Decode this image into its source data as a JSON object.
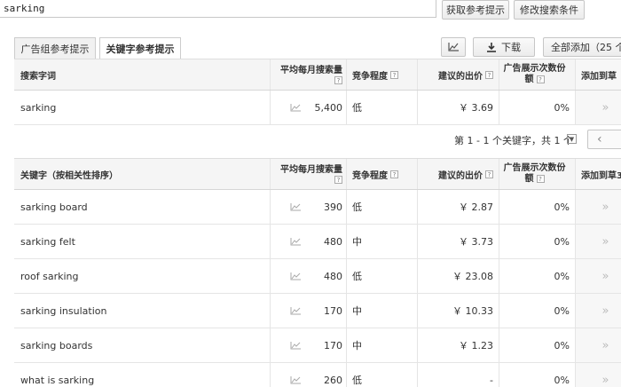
{
  "search": {
    "value": "sarking"
  },
  "buttons": {
    "get_ideas": "获取参考提示",
    "modify": "修改搜索条件"
  },
  "tabs": [
    {
      "label": "广告组参考提示"
    },
    {
      "label": "关键字参考提示"
    }
  ],
  "toolbar": {
    "download": "下载",
    "add_all": "全部添加（25 个"
  },
  "columns": {
    "search_term": "搜索字词",
    "keyword": "关键字（按相关性排序）",
    "volume": "平均每月搜索量",
    "competition": "竞争程度",
    "bid": "建议的出价",
    "share_1": "广告展示次数份",
    "share_2": "额",
    "add": "添加到草",
    "add_2": "添加到草3",
    "help": "?"
  },
  "search_row": {
    "keyword": "sarking",
    "volume": "5,400",
    "competition": "低",
    "bid": "￥ 3.69",
    "share": "0%"
  },
  "pager": {
    "text": "第 1 - 1 个关键字，共 1 个"
  },
  "keywords": [
    {
      "keyword": "sarking board",
      "volume": "390",
      "competition": "低",
      "bid": "￥ 2.87",
      "share": "0%"
    },
    {
      "keyword": "sarking felt",
      "volume": "480",
      "competition": "中",
      "bid": "￥ 3.73",
      "share": "0%"
    },
    {
      "keyword": "roof sarking",
      "volume": "480",
      "competition": "低",
      "bid": "￥ 23.08",
      "share": "0%"
    },
    {
      "keyword": "sarking insulation",
      "volume": "170",
      "competition": "中",
      "bid": "￥ 10.33",
      "share": "0%"
    },
    {
      "keyword": "sarking boards",
      "volume": "170",
      "competition": "中",
      "bid": "￥ 1.23",
      "share": "0%"
    },
    {
      "keyword": "what is sarking",
      "volume": "260",
      "competition": "低",
      "bid": "-",
      "share": "0%"
    }
  ],
  "icons": {
    "add_arrow": "»",
    "prev": "‹",
    "dropdown": "▼"
  }
}
